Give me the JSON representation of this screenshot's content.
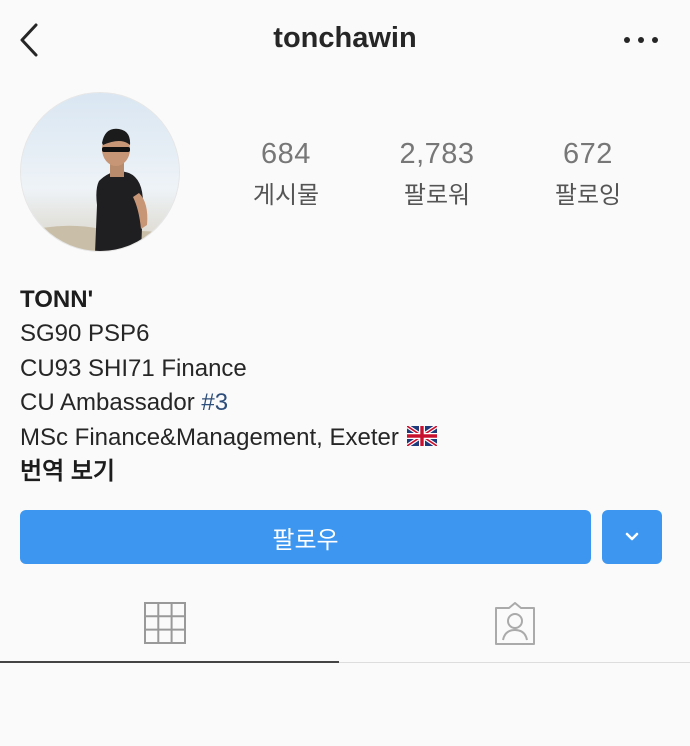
{
  "header": {
    "username": "tonchawin",
    "back_icon": "chevron-left-icon",
    "more_icon": "ellipsis-icon"
  },
  "stats": [
    {
      "value": "684",
      "label": "게시물"
    },
    {
      "value": "2,783",
      "label": "팔로워"
    },
    {
      "value": "672",
      "label": "팔로잉"
    }
  ],
  "bio": {
    "name": "TONN'",
    "lines": [
      "SG90 PSP6",
      "CU93 SHI71 Finance"
    ],
    "ambassador_prefix": "CU Ambassador ",
    "ambassador_hashtag": "#3",
    "msc_line": "MSc Finance&Management, Exeter",
    "flag_icon": "uk-flag-icon",
    "translate": "번역 보기"
  },
  "actions": {
    "follow_label": "팔로우",
    "dropdown_icon": "chevron-down-icon"
  },
  "tabs": {
    "grid_icon": "grid-icon",
    "tagged_icon": "tagged-photos-icon",
    "active": "grid"
  },
  "colors": {
    "accent": "#3d97f0",
    "hashtag": "#2d4e7a",
    "background": "#fafafa"
  }
}
